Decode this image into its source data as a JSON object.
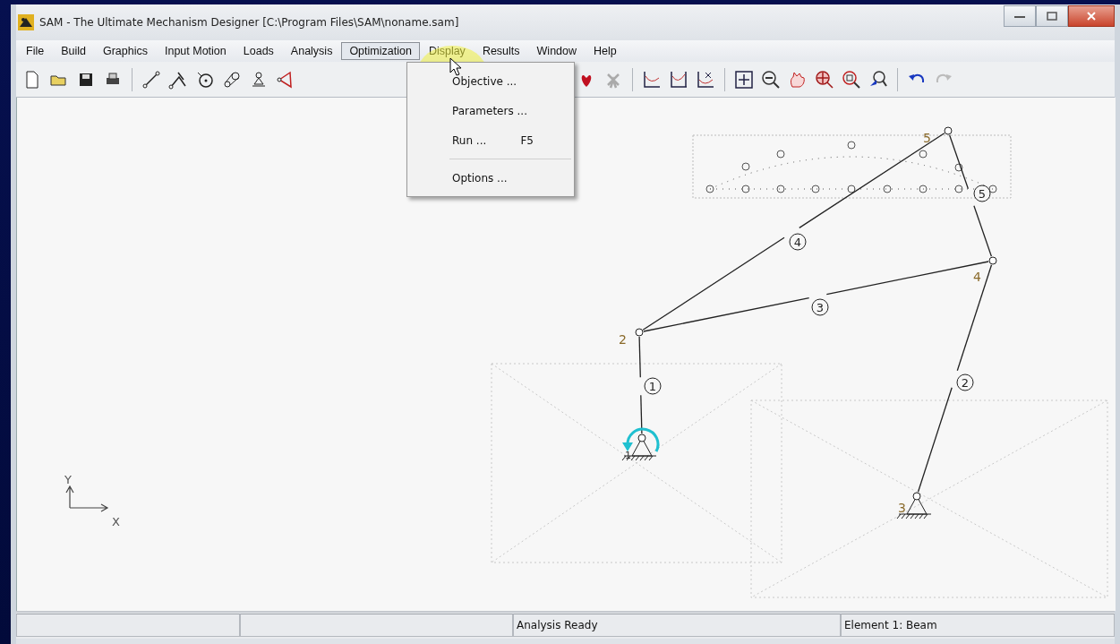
{
  "window": {
    "title": "SAM - The Ultimate Mechanism Designer [C:\\Program Files\\SAM\\noname.sam]"
  },
  "menu": [
    {
      "label": "File",
      "selected": false
    },
    {
      "label": "Build",
      "selected": false
    },
    {
      "label": "Graphics",
      "selected": false
    },
    {
      "label": "Input Motion",
      "selected": false
    },
    {
      "label": "Loads",
      "selected": false
    },
    {
      "label": "Analysis",
      "selected": false
    },
    {
      "label": "Optimization",
      "selected": true
    },
    {
      "label": "Display",
      "selected": false
    },
    {
      "label": "Results",
      "selected": false
    },
    {
      "label": "Window",
      "selected": false
    },
    {
      "label": "Help",
      "selected": false
    }
  ],
  "dropdown": {
    "items": [
      {
        "label": "Objective ...",
        "separator_before": false
      },
      {
        "label": "Parameters ...",
        "separator_before": false
      },
      {
        "label": "Run ...",
        "shortcut": "F5",
        "separator_before": false
      },
      {
        "label": "Options ...",
        "separator_before": true
      }
    ]
  },
  "canvas": {
    "nodes": [
      {
        "label": "1"
      },
      {
        "label": "2"
      },
      {
        "label": "3"
      },
      {
        "label": "4"
      },
      {
        "label": "5"
      }
    ],
    "elements": [
      {
        "label": "1"
      },
      {
        "label": "2"
      },
      {
        "label": "3"
      },
      {
        "label": "4"
      },
      {
        "label": "5"
      }
    ],
    "axes": {
      "y": "Y",
      "x": "X"
    }
  },
  "status_bar": {
    "message": "Analysis Ready",
    "element": "Element 1: Beam"
  }
}
